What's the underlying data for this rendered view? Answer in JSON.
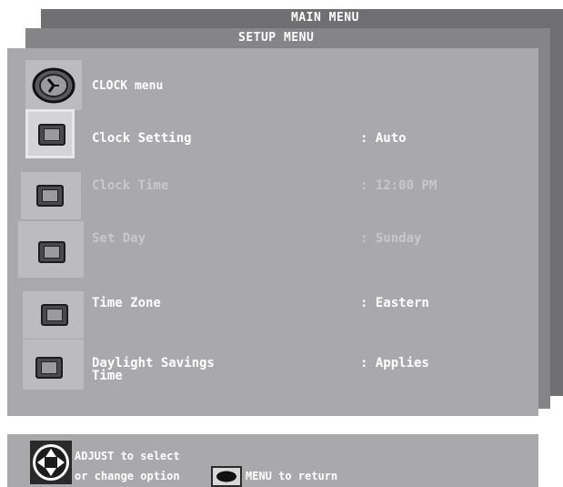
{
  "main_menu": {
    "title": "MAIN MENU"
  },
  "setup_menu": {
    "title": "SETUP MENU"
  },
  "clock_menu": {
    "title": "CLOCK menu",
    "icon": "clock-icon"
  },
  "rows": [
    {
      "label": "Clock Setting",
      "value": ": Auto",
      "state": "selected"
    },
    {
      "label": "Clock Time",
      "value": ": 12:00 PM",
      "state": "disabled"
    },
    {
      "label": "Set Day",
      "value": ": Sunday",
      "state": "disabled"
    },
    {
      "label": "Time Zone",
      "value": ": Eastern",
      "state": "enabled"
    },
    {
      "label": "Daylight Savings\nTime",
      "value": ": Applies",
      "state": "enabled"
    }
  ],
  "footer": {
    "adjust_hint": "ADJUST to select",
    "change_hint": "or change option",
    "menu_hint": "MENU to return",
    "adjust_icon": "dpad-icon",
    "menu_icon": "menu-button-icon"
  },
  "colors": {
    "panel": "#a9a9ac",
    "text_active": "#ffffff",
    "text_dim": "#c8c8ca"
  }
}
